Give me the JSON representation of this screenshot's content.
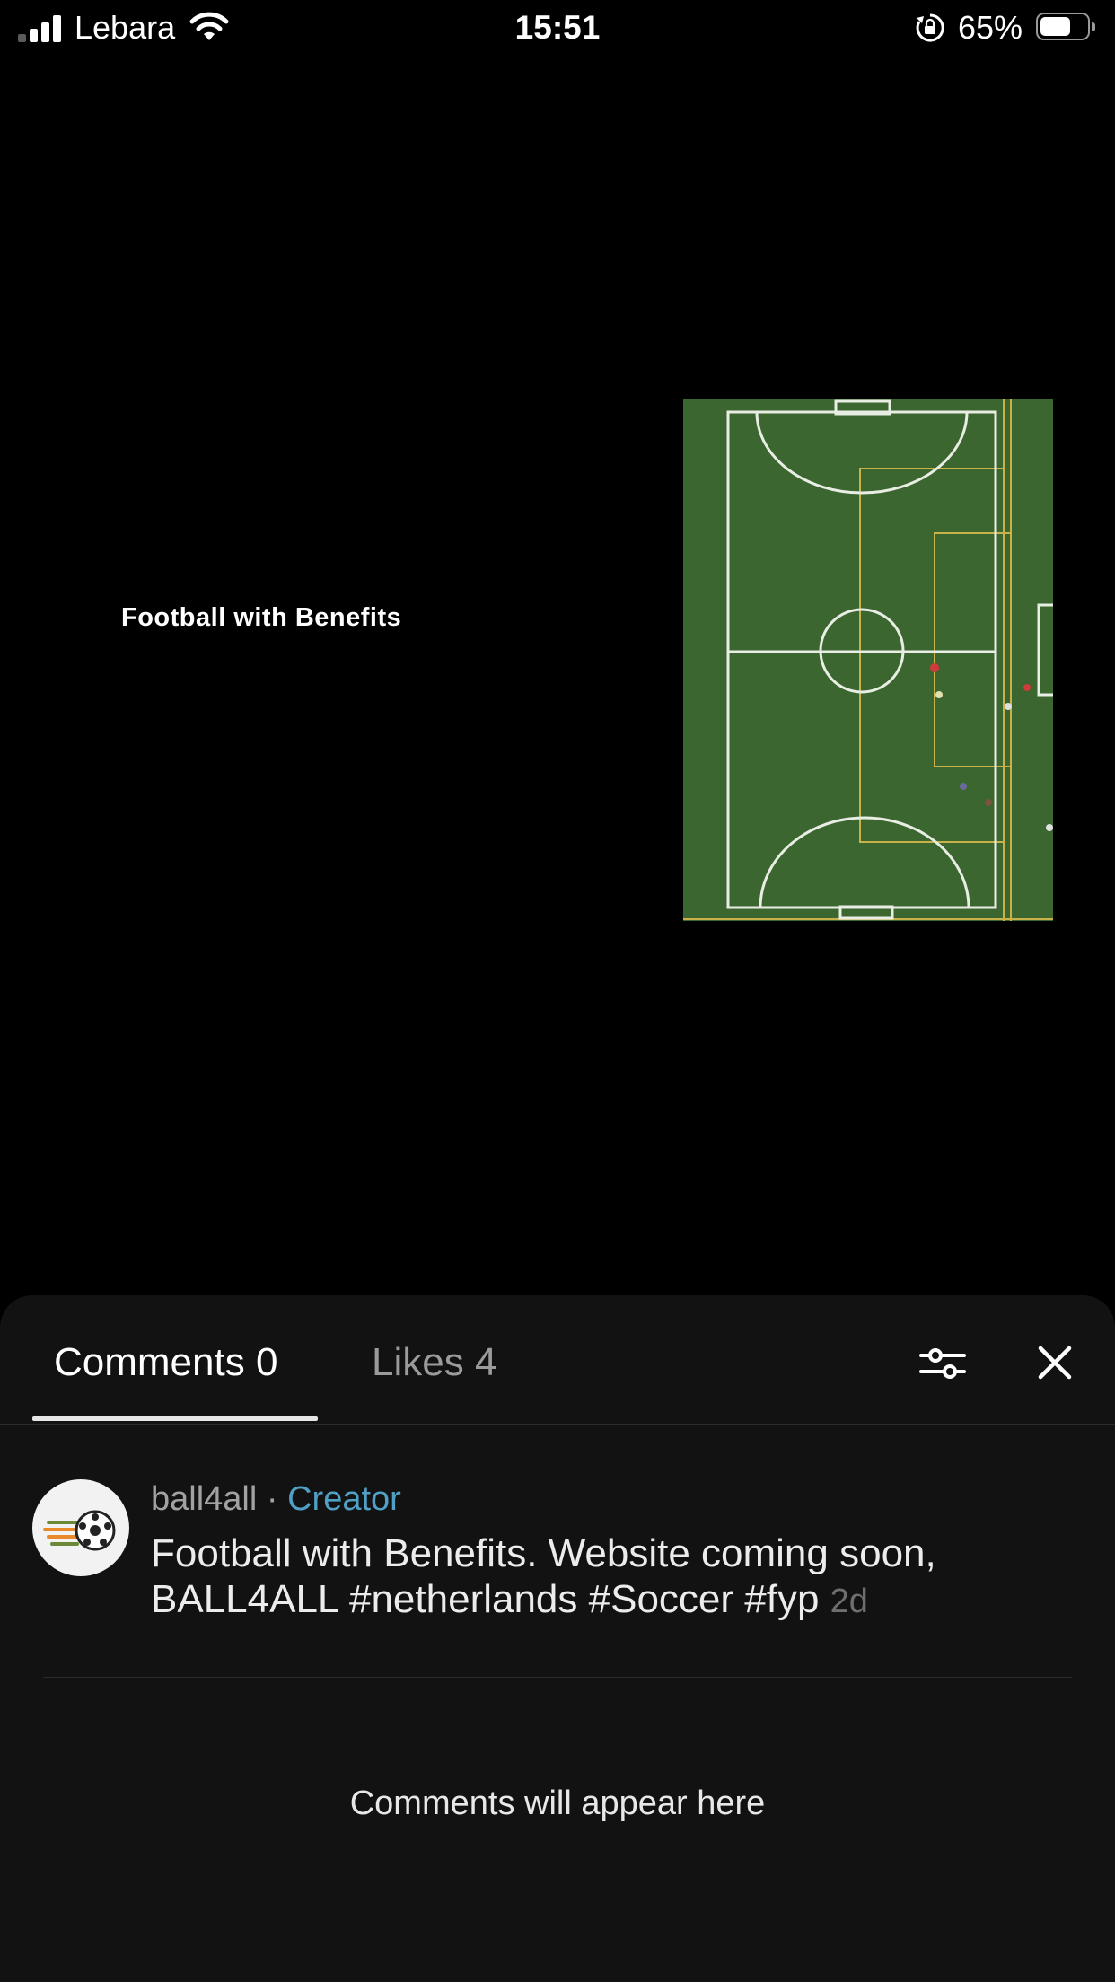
{
  "status_bar": {
    "carrier": "Lebara",
    "time": "15:51",
    "battery_percent": "65%",
    "battery_level": 0.65,
    "signal_bars_active": 2,
    "signal_bars_total": 4
  },
  "video": {
    "overlay_text": "Football with Benefits",
    "image_icon": "football-pitch-aerial"
  },
  "comments_sheet": {
    "tabs": [
      {
        "label": "Comments 0",
        "active": true
      },
      {
        "label": "Likes 4",
        "active": false
      }
    ],
    "filter_icon": "sliders-icon",
    "close_icon": "close-icon",
    "comment": {
      "author": "ball4all",
      "separator": " · ",
      "role": "Creator",
      "text": "Football with Benefits. Website coming soon, BALL4ALL  #netherlands #Soccer #fyp",
      "time": "2d"
    },
    "empty_message": "Comments will appear here"
  },
  "colors": {
    "background": "#000000",
    "sheet": "#121212",
    "creator_accent": "#4fa0c4",
    "pitch_green": "#3f6b33"
  }
}
